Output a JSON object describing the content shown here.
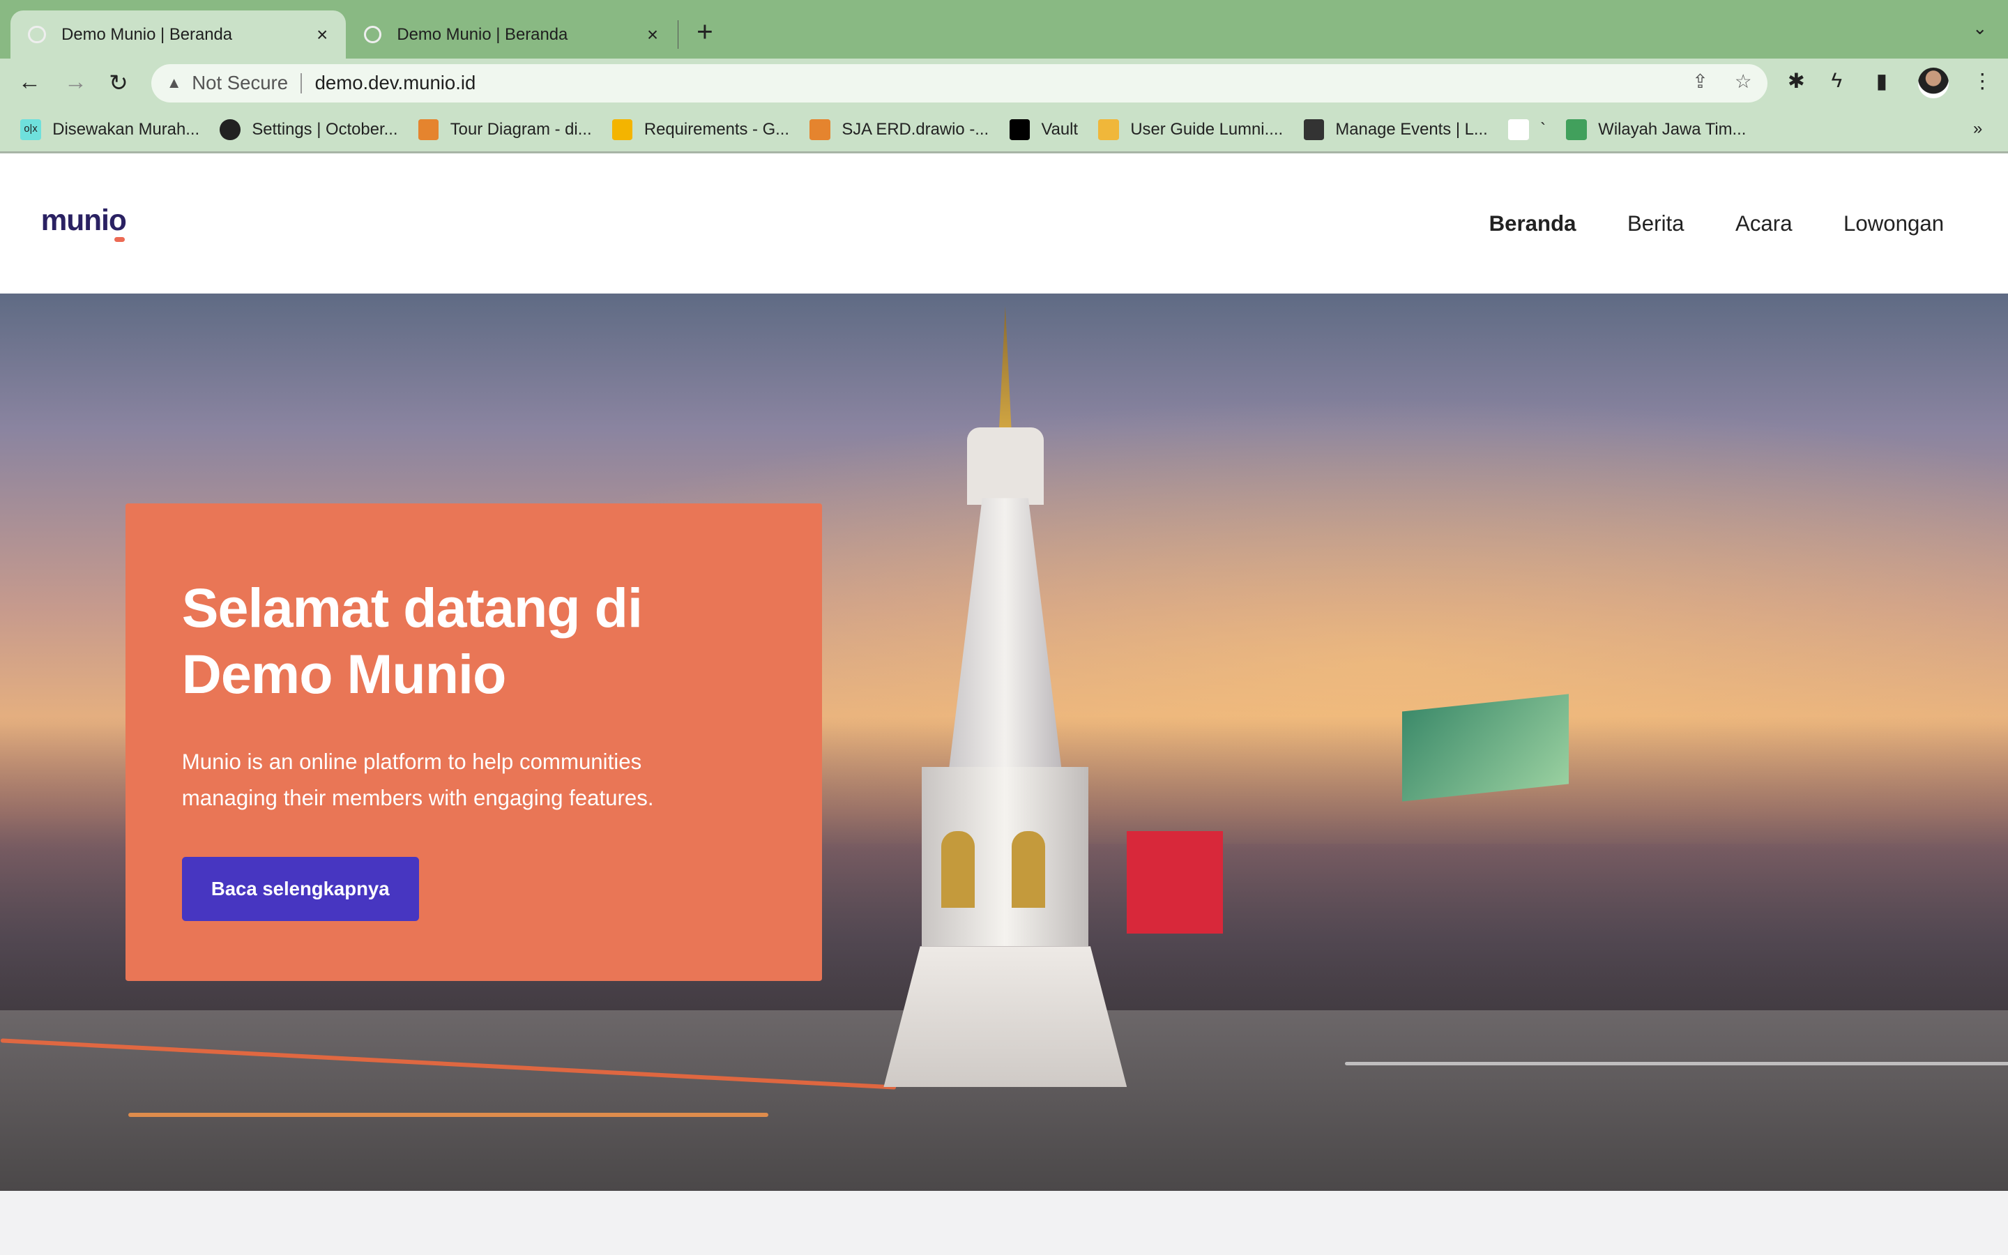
{
  "browser": {
    "tabs": [
      {
        "title": "Demo Munio | Beranda",
        "active": true
      },
      {
        "title": "Demo Munio | Beranda",
        "active": false
      }
    ],
    "close_glyph": "×",
    "new_tab_glyph": "+",
    "tab_menu_glyph": "⌄",
    "security_label": "Not Secure",
    "url": "demo.dev.munio.id",
    "bookmarks": [
      {
        "label": "Disewakan Murah...",
        "icon": "olx-icon",
        "color": "#6fe0dc",
        "glyph": "o|x"
      },
      {
        "label": "Settings | October...",
        "icon": "globe-icon",
        "color": "#222222",
        "glyph": ""
      },
      {
        "label": "Tour Diagram - di...",
        "icon": "drawio-icon",
        "color": "#e5842e",
        "glyph": ""
      },
      {
        "label": "Requirements - G...",
        "icon": "google-drive-icon",
        "color": "#f4b400",
        "glyph": ""
      },
      {
        "label": "SJA ERD.drawio -...",
        "icon": "drawio-icon",
        "color": "#e5842e",
        "glyph": ""
      },
      {
        "label": "Vault",
        "icon": "vault-icon",
        "color": "#000000",
        "glyph": ""
      },
      {
        "label": "User Guide Lumni....",
        "icon": "google-slides-icon",
        "color": "#f0b73a",
        "glyph": ""
      },
      {
        "label": "Manage Events | L...",
        "icon": "leaf-icon",
        "color": "#333333",
        "glyph": ""
      },
      {
        "label": "`",
        "icon": "flag-icon",
        "color": "#ffffff",
        "glyph": ""
      },
      {
        "label": "Wilayah Jawa Tim...",
        "icon": "google-sheets-icon",
        "color": "#41a05c",
        "glyph": ""
      }
    ],
    "bookmarks_more": "»"
  },
  "site": {
    "logo": "munio",
    "nav": [
      {
        "label": "Beranda",
        "active": true
      },
      {
        "label": "Berita",
        "active": false
      },
      {
        "label": "Acara",
        "active": false
      },
      {
        "label": "Lowongan",
        "active": false
      }
    ]
  },
  "hero": {
    "title_line1": "Selamat datang di",
    "title_line2": "Demo Munio",
    "description": "Munio is an online platform to help communities managing their members with engaging features.",
    "cta": "Baca selengkapnya",
    "card_color": "#e97656",
    "cta_color": "#4736c1"
  }
}
